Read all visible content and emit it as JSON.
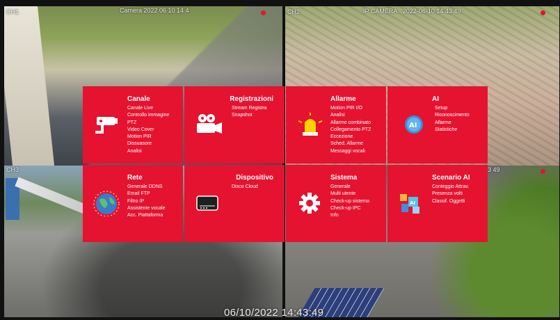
{
  "cameras": [
    {
      "label": "CH1",
      "overlay": "Camera 2022 06 10 14 4   ",
      "name": "cam1"
    },
    {
      "label": "CH2",
      "overlay": "IP CAMERA   2022-06-10 14 43 49"
    },
    {
      "label": "CH3",
      "overlay": ""
    },
    {
      "label": "",
      "overlay": "43 49"
    }
  ],
  "osd_timestamp": "06/10/2022 14:43:49",
  "menu": {
    "canale": {
      "title": "Canale",
      "items": [
        "Canale   Live",
        "Controllo immagine",
        "PTZ",
        "Video Cover",
        "Motion   PIR",
        "Dissuasore",
        "Analisi"
      ]
    },
    "registrazioni": {
      "title": "Registrazioni",
      "items": [
        "Stream   Registra",
        "Snapshot"
      ]
    },
    "allarme": {
      "title": "Allarme",
      "items": [
        "Motion   PIR   I/O",
        "Analisi",
        "Allarme combinato",
        "Collegamento PTZ",
        "Eccezione",
        "Sched. Allarme",
        "Messaggi vocali"
      ]
    },
    "ai": {
      "title": "AI",
      "items": [
        "Setup",
        "Riconoscimento",
        "Allarme",
        "Statistiche"
      ]
    },
    "rete": {
      "title": "Rete",
      "items": [
        "Generale   DDNS",
        "Email   FTP",
        "Filtro IP",
        "Assistente vocale",
        "Acc. Piattaforma"
      ]
    },
    "dispositivo": {
      "title": "Dispositivo",
      "items": [
        "Disco   Cloud"
      ]
    },
    "sistema": {
      "title": "Sistema",
      "items": [
        "Generale",
        "Multi utente",
        "Check-up sistema",
        "Check-up IPC",
        "Info"
      ]
    },
    "scenario": {
      "title": "Scenario AI",
      "items": [
        "Conteggio Attrav.",
        "Presenza volti",
        "Classif. Oggetti"
      ]
    }
  },
  "icons": {
    "canale": "security-camera-icon",
    "registrazioni": "video-camera-icon",
    "allarme": "alarm-light-icon",
    "ai": "ai-head-icon",
    "rete": "globe-network-icon",
    "dispositivo": "hard-disk-icon",
    "sistema": "gear-icon",
    "scenario": "ai-scenario-icon"
  },
  "colors": {
    "tile": "#e5132f",
    "rec": "#e0162d"
  }
}
